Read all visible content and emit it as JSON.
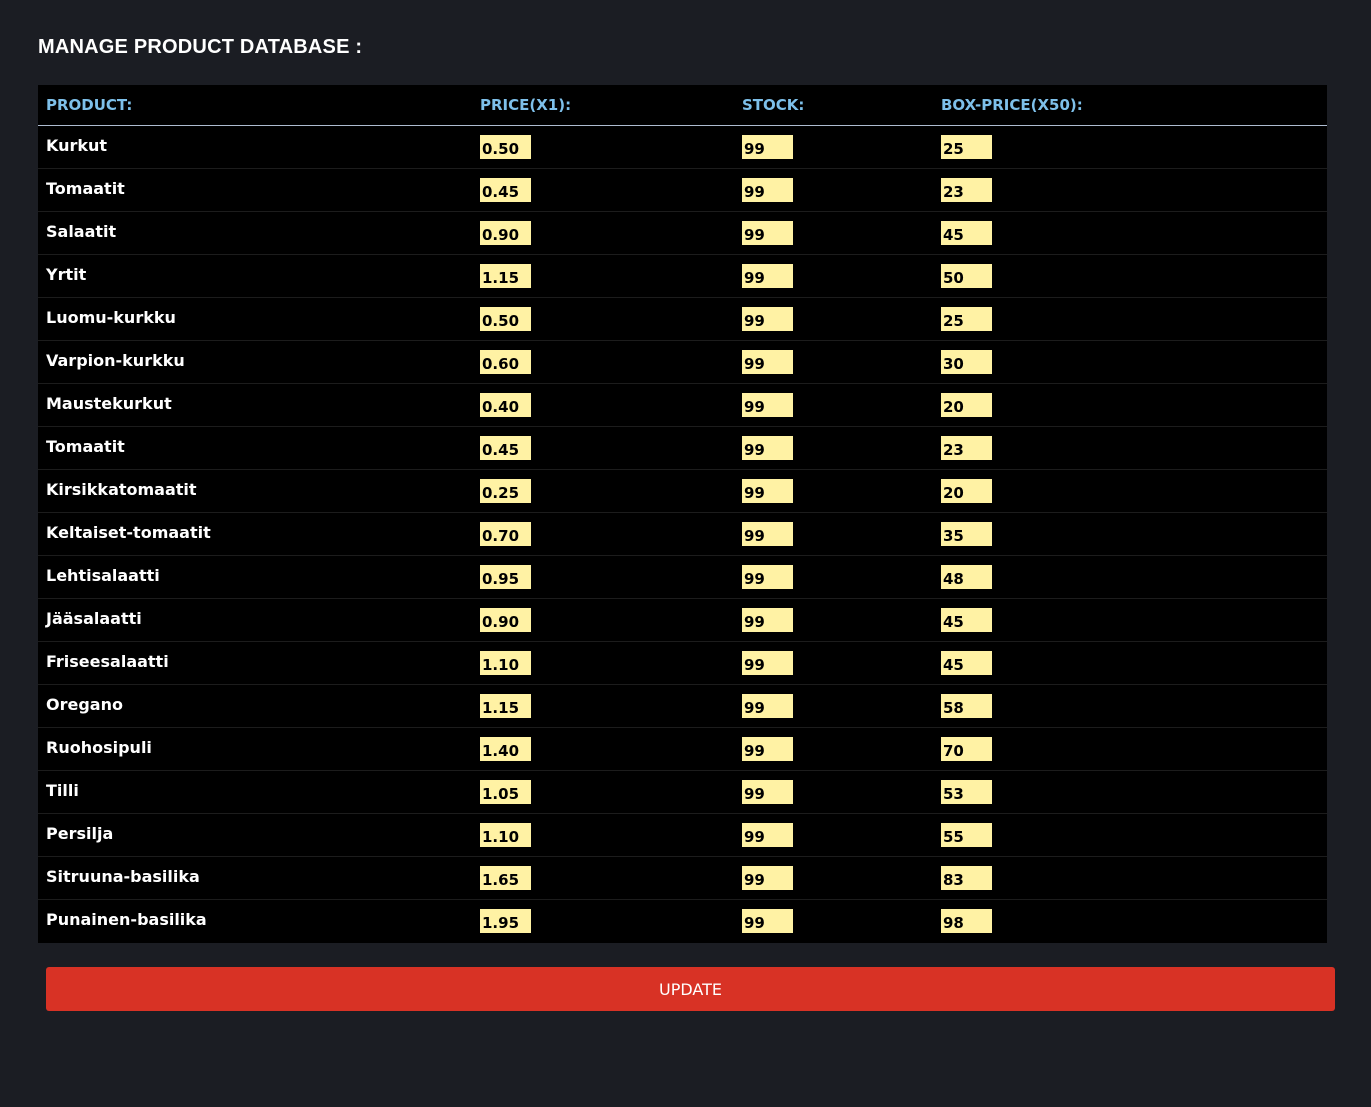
{
  "page": {
    "title": "MANAGE PRODUCT DATABASE :"
  },
  "table": {
    "headers": {
      "product": "PRODUCT:",
      "price": "PRICE(X1):",
      "stock": "STOCK:",
      "box_price": "BOX-PRICE(X50):"
    },
    "rows": [
      {
        "product": "Kurkut",
        "price": "0.50",
        "stock": "99",
        "box_price": "25"
      },
      {
        "product": "Tomaatit",
        "price": "0.45",
        "stock": "99",
        "box_price": "23"
      },
      {
        "product": "Salaatit",
        "price": "0.90",
        "stock": "99",
        "box_price": "45"
      },
      {
        "product": "Yrtit",
        "price": "1.15",
        "stock": "99",
        "box_price": "50"
      },
      {
        "product": "Luomu-kurkku",
        "price": "0.50",
        "stock": "99",
        "box_price": "25"
      },
      {
        "product": "Varpion-kurkku",
        "price": "0.60",
        "stock": "99",
        "box_price": "30"
      },
      {
        "product": "Maustekurkut",
        "price": "0.40",
        "stock": "99",
        "box_price": "20"
      },
      {
        "product": "Tomaatit",
        "price": "0.45",
        "stock": "99",
        "box_price": "23"
      },
      {
        "product": "Kirsikkatomaatit",
        "price": "0.25",
        "stock": "99",
        "box_price": "20"
      },
      {
        "product": "Keltaiset-tomaatit",
        "price": "0.70",
        "stock": "99",
        "box_price": "35"
      },
      {
        "product": "Lehtisalaatti",
        "price": "0.95",
        "stock": "99",
        "box_price": "48"
      },
      {
        "product": "Jääsalaatti",
        "price": "0.90",
        "stock": "99",
        "box_price": "45"
      },
      {
        "product": "Friseesalaatti",
        "price": "1.10",
        "stock": "99",
        "box_price": "45"
      },
      {
        "product": "Oregano",
        "price": "1.15",
        "stock": "99",
        "box_price": "58"
      },
      {
        "product": "Ruohosipuli",
        "price": "1.40",
        "stock": "99",
        "box_price": "70"
      },
      {
        "product": "Tilli",
        "price": "1.05",
        "stock": "99",
        "box_price": "53"
      },
      {
        "product": "Persilja",
        "price": "1.10",
        "stock": "99",
        "box_price": "55"
      },
      {
        "product": "Sitruuna-basilika",
        "price": "1.65",
        "stock": "99",
        "box_price": "83"
      },
      {
        "product": "Punainen-basilika",
        "price": "1.95",
        "stock": "99",
        "box_price": "98"
      }
    ]
  },
  "actions": {
    "update_label": "UPDATE"
  },
  "colors": {
    "background": "#1b1d23",
    "table_background": "#000000",
    "header_text": "#7ec0ea",
    "input_background": "#fff2a4",
    "update_button": "#d83225"
  }
}
